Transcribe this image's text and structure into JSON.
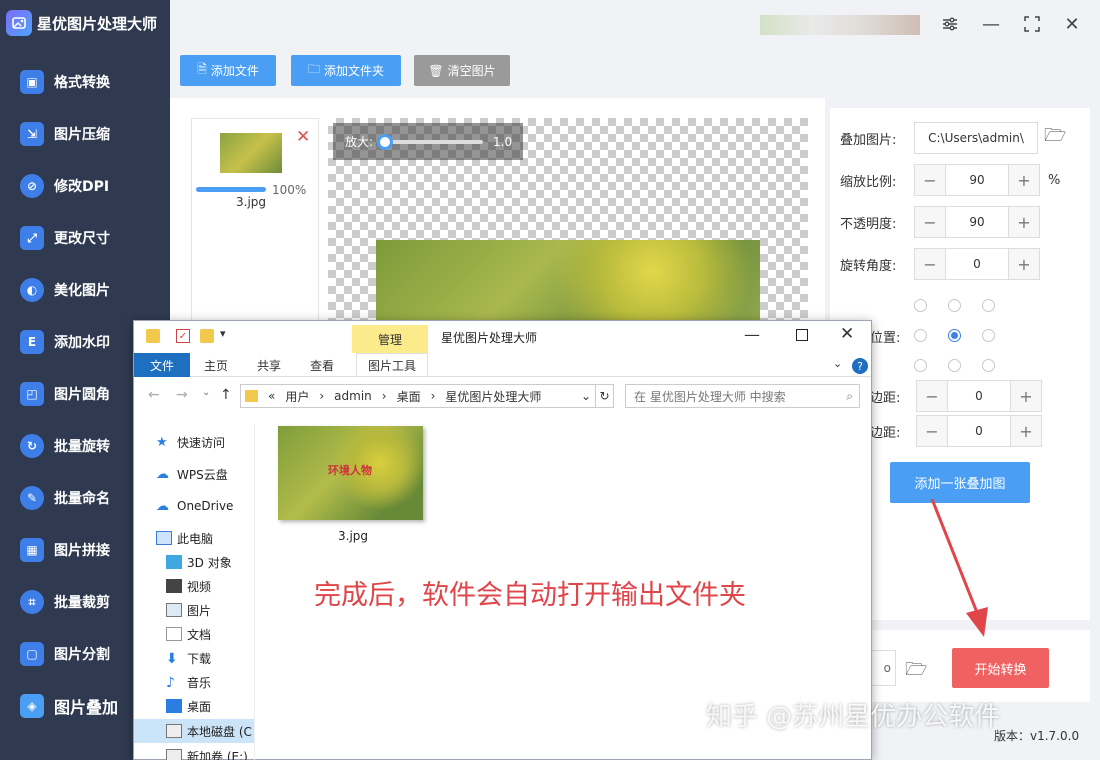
{
  "app": {
    "title": "星优图片处理大师",
    "version": "版本：v1.7.0.0",
    "watermark": "知乎 @苏州星优办公软件"
  },
  "sidebar": {
    "items": [
      {
        "label": "格式转换",
        "icon": "image-format-icon"
      },
      {
        "label": "图片压缩",
        "icon": "compress-icon"
      },
      {
        "label": "修改DPI",
        "icon": "dpi-icon"
      },
      {
        "label": "更改尺寸",
        "icon": "resize-icon"
      },
      {
        "label": "美化图片",
        "icon": "beautify-icon"
      },
      {
        "label": "添加水印",
        "icon": "watermark-icon"
      },
      {
        "label": "图片圆角",
        "icon": "round-corner-icon"
      },
      {
        "label": "批量旋转",
        "icon": "rotate-icon"
      },
      {
        "label": "批量命名",
        "icon": "rename-icon"
      },
      {
        "label": "图片拼接",
        "icon": "stitch-icon"
      },
      {
        "label": "批量裁剪",
        "icon": "crop-icon"
      },
      {
        "label": "图片分割",
        "icon": "split-icon"
      },
      {
        "label": "图片叠加",
        "icon": "layers-icon"
      }
    ]
  },
  "toolbar": {
    "add_file": "添加文件",
    "add_folder": "添加文件夹",
    "clear": "清空图片"
  },
  "filelist": {
    "name": "3.jpg",
    "progress_text": "100%",
    "progress": 1.0
  },
  "preview": {
    "zoom_label": "放大:",
    "zoom_value": "1.0"
  },
  "settings": {
    "overlay_label": "叠加图片:",
    "overlay_path": "C:\\Users\\admin\\",
    "scale_label": "缩放比例:",
    "scale_value": "90",
    "scale_unit": "%",
    "opacity_label": "不透明度:",
    "opacity_value": "90",
    "rotate_label": "旋转角度:",
    "rotate_value": "0",
    "position_label": "位置:",
    "margin_h_label": "边距:",
    "margin_h_value": "0",
    "margin_v_label": "边距:",
    "margin_v_value": "0",
    "add_overlay": "添加一张叠加图",
    "output_fragment": "o",
    "start": "开始转换"
  },
  "explorer": {
    "title": "星优图片处理大师",
    "manage_tab": "管理",
    "ribbon_tabs": [
      "文件",
      "主页",
      "共享",
      "查看",
      "图片工具"
    ],
    "path": [
      "用户",
      "admin",
      "桌面",
      "星优图片处理大师"
    ],
    "search_placeholder": "在 星优图片处理大师 中搜索",
    "nav": [
      {
        "label": "快速访问"
      },
      {
        "label": "WPS云盘"
      },
      {
        "label": "OneDrive"
      },
      {
        "label": "此电脑"
      },
      {
        "label": "3D 对象"
      },
      {
        "label": "视频"
      },
      {
        "label": "图片"
      },
      {
        "label": "文档"
      },
      {
        "label": "下载"
      },
      {
        "label": "音乐"
      },
      {
        "label": "桌面"
      },
      {
        "label": "本地磁盘 (C"
      },
      {
        "label": "新加卷 (E:)"
      }
    ],
    "file_name": "3.jpg",
    "file_overlay_text": "环境人物",
    "annotation": "完成后，软件会自动打开输出文件夹"
  },
  "colors": {
    "sidebar_bg": "#2f3a50",
    "accent_blue": "#4a9ff5",
    "start_red": "#f06262",
    "annotation_red": "#e0454a"
  }
}
